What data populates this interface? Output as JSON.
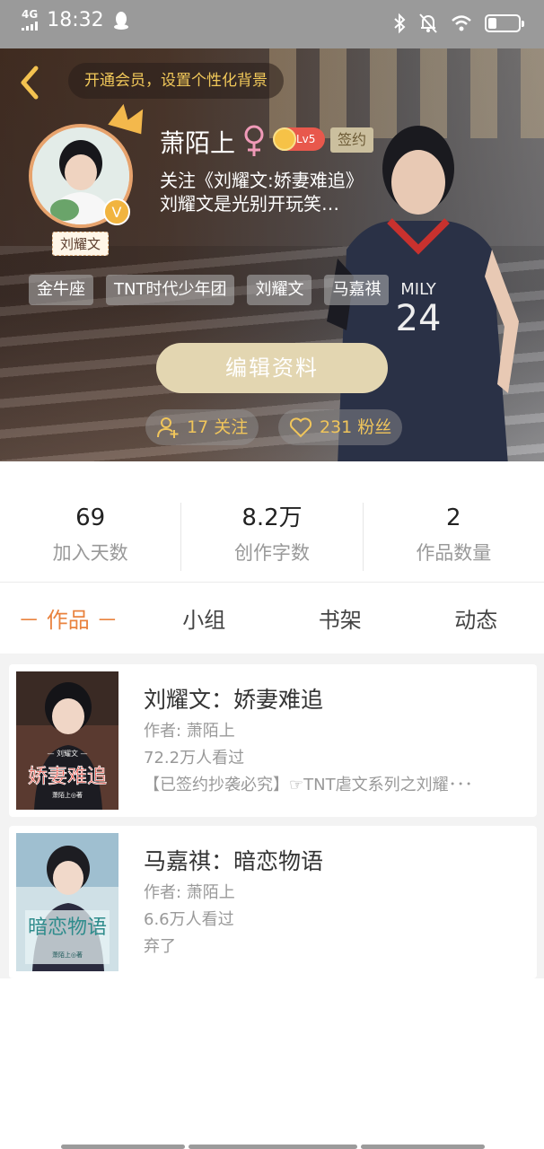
{
  "status_bar": {
    "network": "4G",
    "time": "18:32"
  },
  "header": {
    "member_banner": "开通会员，设置个性化背景",
    "username": "萧陌上",
    "level": "Lv5",
    "sign_badge": "签约",
    "avatar_tag": "刘耀文",
    "bio_line1": "关注《刘耀文:娇妻难追》",
    "bio_line2": "刘耀文是光别开玩笑…",
    "tags": [
      "金牛座",
      "TNT时代少年团",
      "刘耀文",
      "马嘉祺"
    ],
    "edit_button": "编辑资料",
    "following": "17 关注",
    "followers": "231 粉丝"
  },
  "stats": [
    {
      "value": "69",
      "label": "加入天数"
    },
    {
      "value": "8.2万",
      "label": "创作字数"
    },
    {
      "value": "2",
      "label": "作品数量"
    }
  ],
  "tabs": [
    "－ 作品 －",
    "小组",
    "书架",
    "动态"
  ],
  "works": [
    {
      "title": "刘耀文：娇妻难追",
      "author": "作者: 萧陌上",
      "views": "72.2万人看过",
      "desc": "【已签约抄袭必究】☞TNT虐文系列之刘耀･･･",
      "cover_text": "娇妻难追",
      "cover_sub": "— 刘耀文 —",
      "cover_author": "萧陌上◎著"
    },
    {
      "title": "马嘉祺：暗恋物语",
      "author": "作者: 萧陌上",
      "views": "6.6万人看过",
      "desc": "弃了",
      "cover_text": "暗恋物语",
      "cover_author": "萧陌上◎著"
    }
  ],
  "colors": {
    "accent": "#e9833f",
    "gold": "#f0c55b",
    "edit_button": "#e3d6b1"
  }
}
